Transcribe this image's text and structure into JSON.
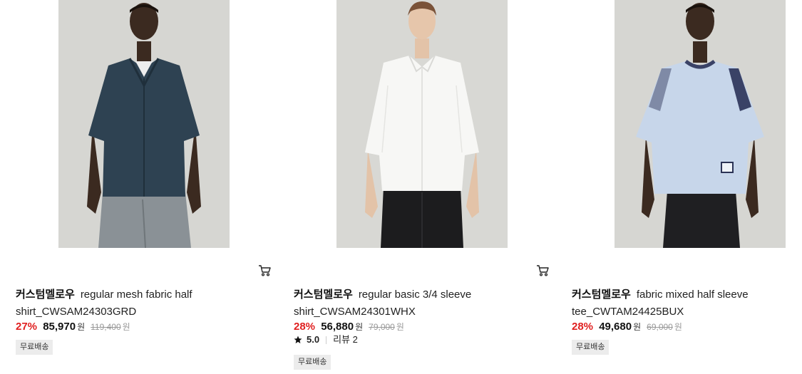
{
  "products": [
    {
      "brand": "커스텀멜로우",
      "name": "regular mesh fabric half shirt_CWSAM24303GRD",
      "discount": "27%",
      "price": "85,970",
      "currency": "원",
      "original_price": "119,400",
      "original_currency": "원",
      "shipping_badge": "무료배송"
    },
    {
      "brand": "커스텀멜로우",
      "name": "regular basic 3/4 sleeve shirt_CWSAM24301WHX",
      "discount": "28%",
      "price": "56,880",
      "currency": "원",
      "original_price": "79,000",
      "original_currency": "원",
      "rating": "5.0",
      "review_text": "리뷰 2",
      "shipping_badge": "무료배송"
    },
    {
      "brand": "커스텀멜로우",
      "name": "fabric mixed half sleeve tee_CWTAM24425BUX",
      "discount": "28%",
      "price": "49,680",
      "currency": "원",
      "original_price": "69,000",
      "original_currency": "원",
      "shipping_badge": "무료배송"
    }
  ],
  "icons": {
    "cart": "cart-icon",
    "star": "star-icon"
  },
  "colors": {
    "discount": "#e02020",
    "badge_bg": "#ececec",
    "thumb_bg": "#d6d6d2"
  }
}
